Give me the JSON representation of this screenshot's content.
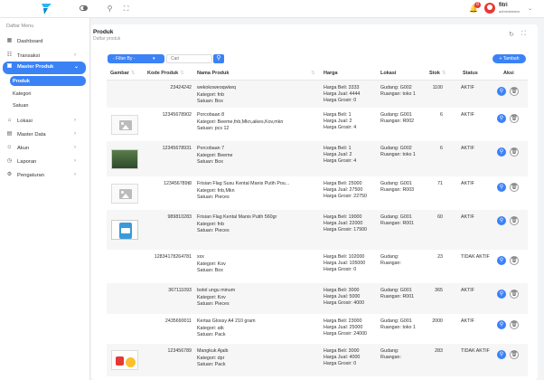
{
  "topbar": {
    "user_name": "fitri",
    "user_role": "administrator",
    "notif_count": "8"
  },
  "sidebar": {
    "title": "Daftar Menu",
    "items": [
      {
        "label": "Dashboard",
        "icon": "dashboard-icon"
      },
      {
        "label": "Transaksi",
        "icon": "cart-icon"
      },
      {
        "label": "Master Produk",
        "icon": "box-icon"
      },
      {
        "label": "Lokasi",
        "icon": "home-icon"
      },
      {
        "label": "Master Data",
        "icon": "database-icon"
      },
      {
        "label": "Akun",
        "icon": "users-icon"
      },
      {
        "label": "Laporan",
        "icon": "clock-icon"
      },
      {
        "label": "Pengaturan",
        "icon": "settings-icon"
      }
    ],
    "subitems": [
      "Produk",
      "Kategori",
      "Satuan"
    ]
  },
  "page": {
    "title": "Produk",
    "breadcrumb": "Daftar produk"
  },
  "toolbar": {
    "filter_label": "- Filter By -",
    "search_placeholder": "Cari",
    "add_label": "+ Tambah"
  },
  "table": {
    "headers": [
      "Gambar",
      "Kode Produk",
      "Nama Produk",
      "Harga",
      "Lokasi",
      "Stok",
      "Status",
      "Aksi"
    ],
    "rows": [
      {
        "kode": "23424242",
        "nama": "wekokoweoqwkeq",
        "kategori": "Kategori: fnb",
        "satuan": "Satuan: Box",
        "beli": "Harga Beli: 3333",
        "jual": "Harga Jual: 4444",
        "grosir": "Harga Grosir: 0",
        "gudang": "Gudang: G002",
        "ruangan": "Ruangan: toko 1",
        "stok": "1100",
        "status": "AKTIF",
        "img": "blank"
      },
      {
        "kode": "12345678902",
        "nama": "Porcobaan 8",
        "kategori": "Kategori: Beeme,fnb,Mkn,aikes,Kov,mkn",
        "satuan": "Satuan: pcs 12",
        "beli": "Harga Beli: 1",
        "jual": "Harga Jual: 2",
        "grosir": "Harga Grosir: 4",
        "gudang": "Gudang: G001",
        "ruangan": "Ruangan: R002",
        "stok": "6",
        "status": "AKTIF",
        "img": "placeholder"
      },
      {
        "kode": "12345678931",
        "nama": "Porcobaan 7",
        "kategori": "Kategori: Beeme",
        "satuan": "Satuan: Box",
        "beli": "Harga Beli: 1",
        "jual": "Harga Jual: 2",
        "grosir": "Harga Grosir: 4",
        "gudang": "Gudang: G002",
        "ruangan": "Ruangan: toko 1",
        "stok": "6",
        "status": "AKTIF",
        "img": "photo"
      },
      {
        "kode": "123456789t8",
        "nama": "Frisian Flag Susu Kental Manis Putih Pou...",
        "kategori": "Kategori: fnb,Mkn",
        "satuan": "Satuan: Pieces",
        "beli": "Harga Beli: 25000",
        "jual": "Harga Jual: 27500",
        "grosir": "Harga Grosir: 22750",
        "gudang": "Gudang: G001",
        "ruangan": "Ruangan: R003",
        "stok": "71",
        "status": "AKTIF",
        "img": "placeholder"
      },
      {
        "kode": "989810283",
        "nama": "Frisian Flag Kental Manis Putih 560gr",
        "kategori": "Kategori: fnb",
        "satuan": "Satuan: Pieces",
        "beli": "Harga Beli: 19000",
        "jual": "Harga Jual: 22000",
        "grosir": "Harga Grosir: 17900",
        "gudang": "Gudang: G001",
        "ruangan": "Ruangan: R001",
        "stok": "60",
        "status": "AKTIF",
        "img": "milk"
      },
      {
        "kode": "12834178264781",
        "nama": "xxx",
        "kategori": "Kategori: Kov",
        "satuan": "Satuan: Box",
        "beli": "Harga Beli: 102000",
        "jual": "Harga Jual: 105000",
        "grosir": "Harga Grosir: 0",
        "gudang": "Gudang:",
        "ruangan": "Ruangan:",
        "stok": "23",
        "status": "TIDAK AKTIF",
        "img": "blank"
      },
      {
        "kode": "367111093",
        "nama": "botol ungu minum",
        "kategori": "Kategori: Kov",
        "satuan": "Satuan: Pieces",
        "beli": "Harga Beli: 3000",
        "jual": "Harga Jual: 5000",
        "grosir": "Harga Grosir: 4000",
        "gudang": "Gudang: G001",
        "ruangan": "Ruangan: R001",
        "stok": "365",
        "status": "AKTIF",
        "img": "blank"
      },
      {
        "kode": "2435690011",
        "nama": "Kertas Glossy A4 210 gram",
        "kategori": "Kategori: atk",
        "satuan": "Satuan: Pack",
        "beli": "Harga Beli: 23000",
        "jual": "Harga Jual: 25000",
        "grosir": "Harga Grosir: 24000",
        "gudang": "Gudang: G001",
        "ruangan": "Ruangan: toko 1",
        "stok": "2000",
        "status": "AKTIF",
        "img": "blank"
      },
      {
        "kode": "123456789",
        "nama": "Mangkuk Ajaib",
        "kategori": "Kategori: dpr",
        "satuan": "Satuan: Pack",
        "beli": "Harga Beli: 3000",
        "jual": "Harga Jual: 4000",
        "grosir": "Harga Grosir: 0",
        "gudang": "Gudang:",
        "ruangan": "Ruangan:",
        "stok": "283",
        "status": "TIDAK AKTIF",
        "img": "snack"
      }
    ]
  }
}
